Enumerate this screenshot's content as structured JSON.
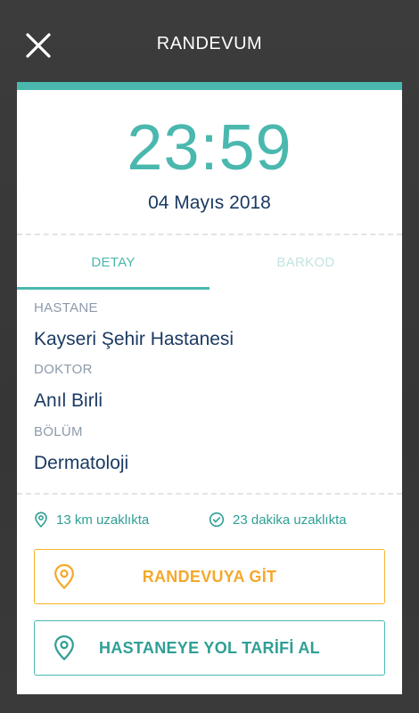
{
  "header": {
    "title": "RANDEVUM",
    "close_icon": "close-icon"
  },
  "appointment": {
    "time": "23:59",
    "date": "04 Mayıs 2018"
  },
  "tabs": [
    {
      "label": "DETAY",
      "active": true
    },
    {
      "label": "BARKOD",
      "active": false
    }
  ],
  "details": {
    "hospital_label": "HASTANE",
    "hospital_value": "Kayseri Şehir Hastanesi",
    "doctor_label": "DOKTOR",
    "doctor_value": "Anıl Birli",
    "department_label": "BÖLÜM",
    "department_value": "Dermatoloji"
  },
  "info": {
    "distance": "13 km uzaklıkta",
    "duration": "23 dakika uzaklıkta",
    "distance_icon": "location-pin-icon",
    "duration_icon": "check-circle-icon"
  },
  "actions": {
    "go_label": "RANDEVUYA GİT",
    "route_label": "HASTANEYE YOL TARİFİ AL"
  },
  "colors": {
    "accent": "#4ab8ae",
    "accent_dark": "#2f9f95",
    "orange": "#f5a82b",
    "navy": "#1b3a63",
    "label_gray": "#8c9aab",
    "background": "#3a3a3a"
  }
}
